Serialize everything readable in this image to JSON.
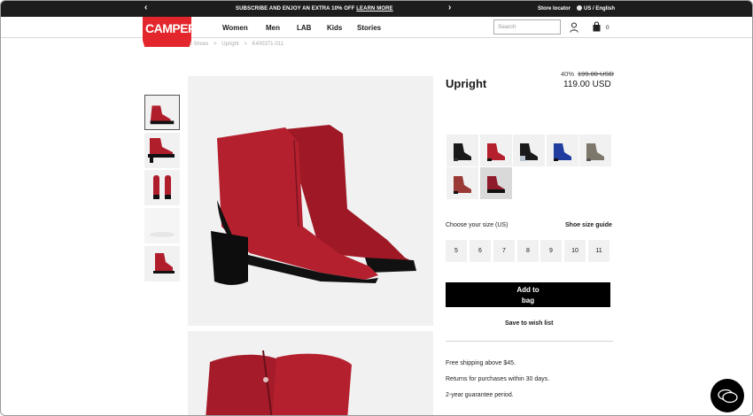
{
  "promo": {
    "message": "SUBSCRIBE AND ENJOY AN EXTRA 10% OFF",
    "link": "LEARN MORE",
    "store_locator": "Store locator",
    "language": "US / English",
    "prev_arrow": "‹",
    "next_arrow": "›"
  },
  "brand": {
    "logo_text": "CAMPER",
    "color": "#e3262b"
  },
  "nav": {
    "links": [
      "Women",
      "Men",
      "LAB",
      "Kids",
      "Stories"
    ],
    "search_placeholder": "Search",
    "bag_count": "0"
  },
  "breadcrumb": [
    "Women Shoes",
    "Upright",
    "K400371-011"
  ],
  "breadcrumb_separator": ">",
  "product": {
    "name": "Upright",
    "discount": "40%",
    "old_price": "199.00 USD",
    "price": "119.00 USD",
    "colors": [
      "black",
      "red",
      "black-silver",
      "blue",
      "taupe",
      "rust",
      "burgundy"
    ],
    "selected_color": "burgundy"
  },
  "sizes": {
    "label": "Choose your size (US)",
    "guide": "Shoe size guide",
    "options": [
      "5",
      "6",
      "7",
      "8",
      "9",
      "10",
      "11"
    ]
  },
  "actions": {
    "add_to_bag": "Add to bag",
    "wishlist": "Save to wish list"
  },
  "info": [
    "Free shipping above $45.",
    "Returns for purchases within 30 days.",
    "2-year guarantee period."
  ],
  "icons": {
    "user": "user-icon",
    "bag": "shopping-bag-icon",
    "globe": "globe-icon",
    "chat": "chat-icon"
  }
}
